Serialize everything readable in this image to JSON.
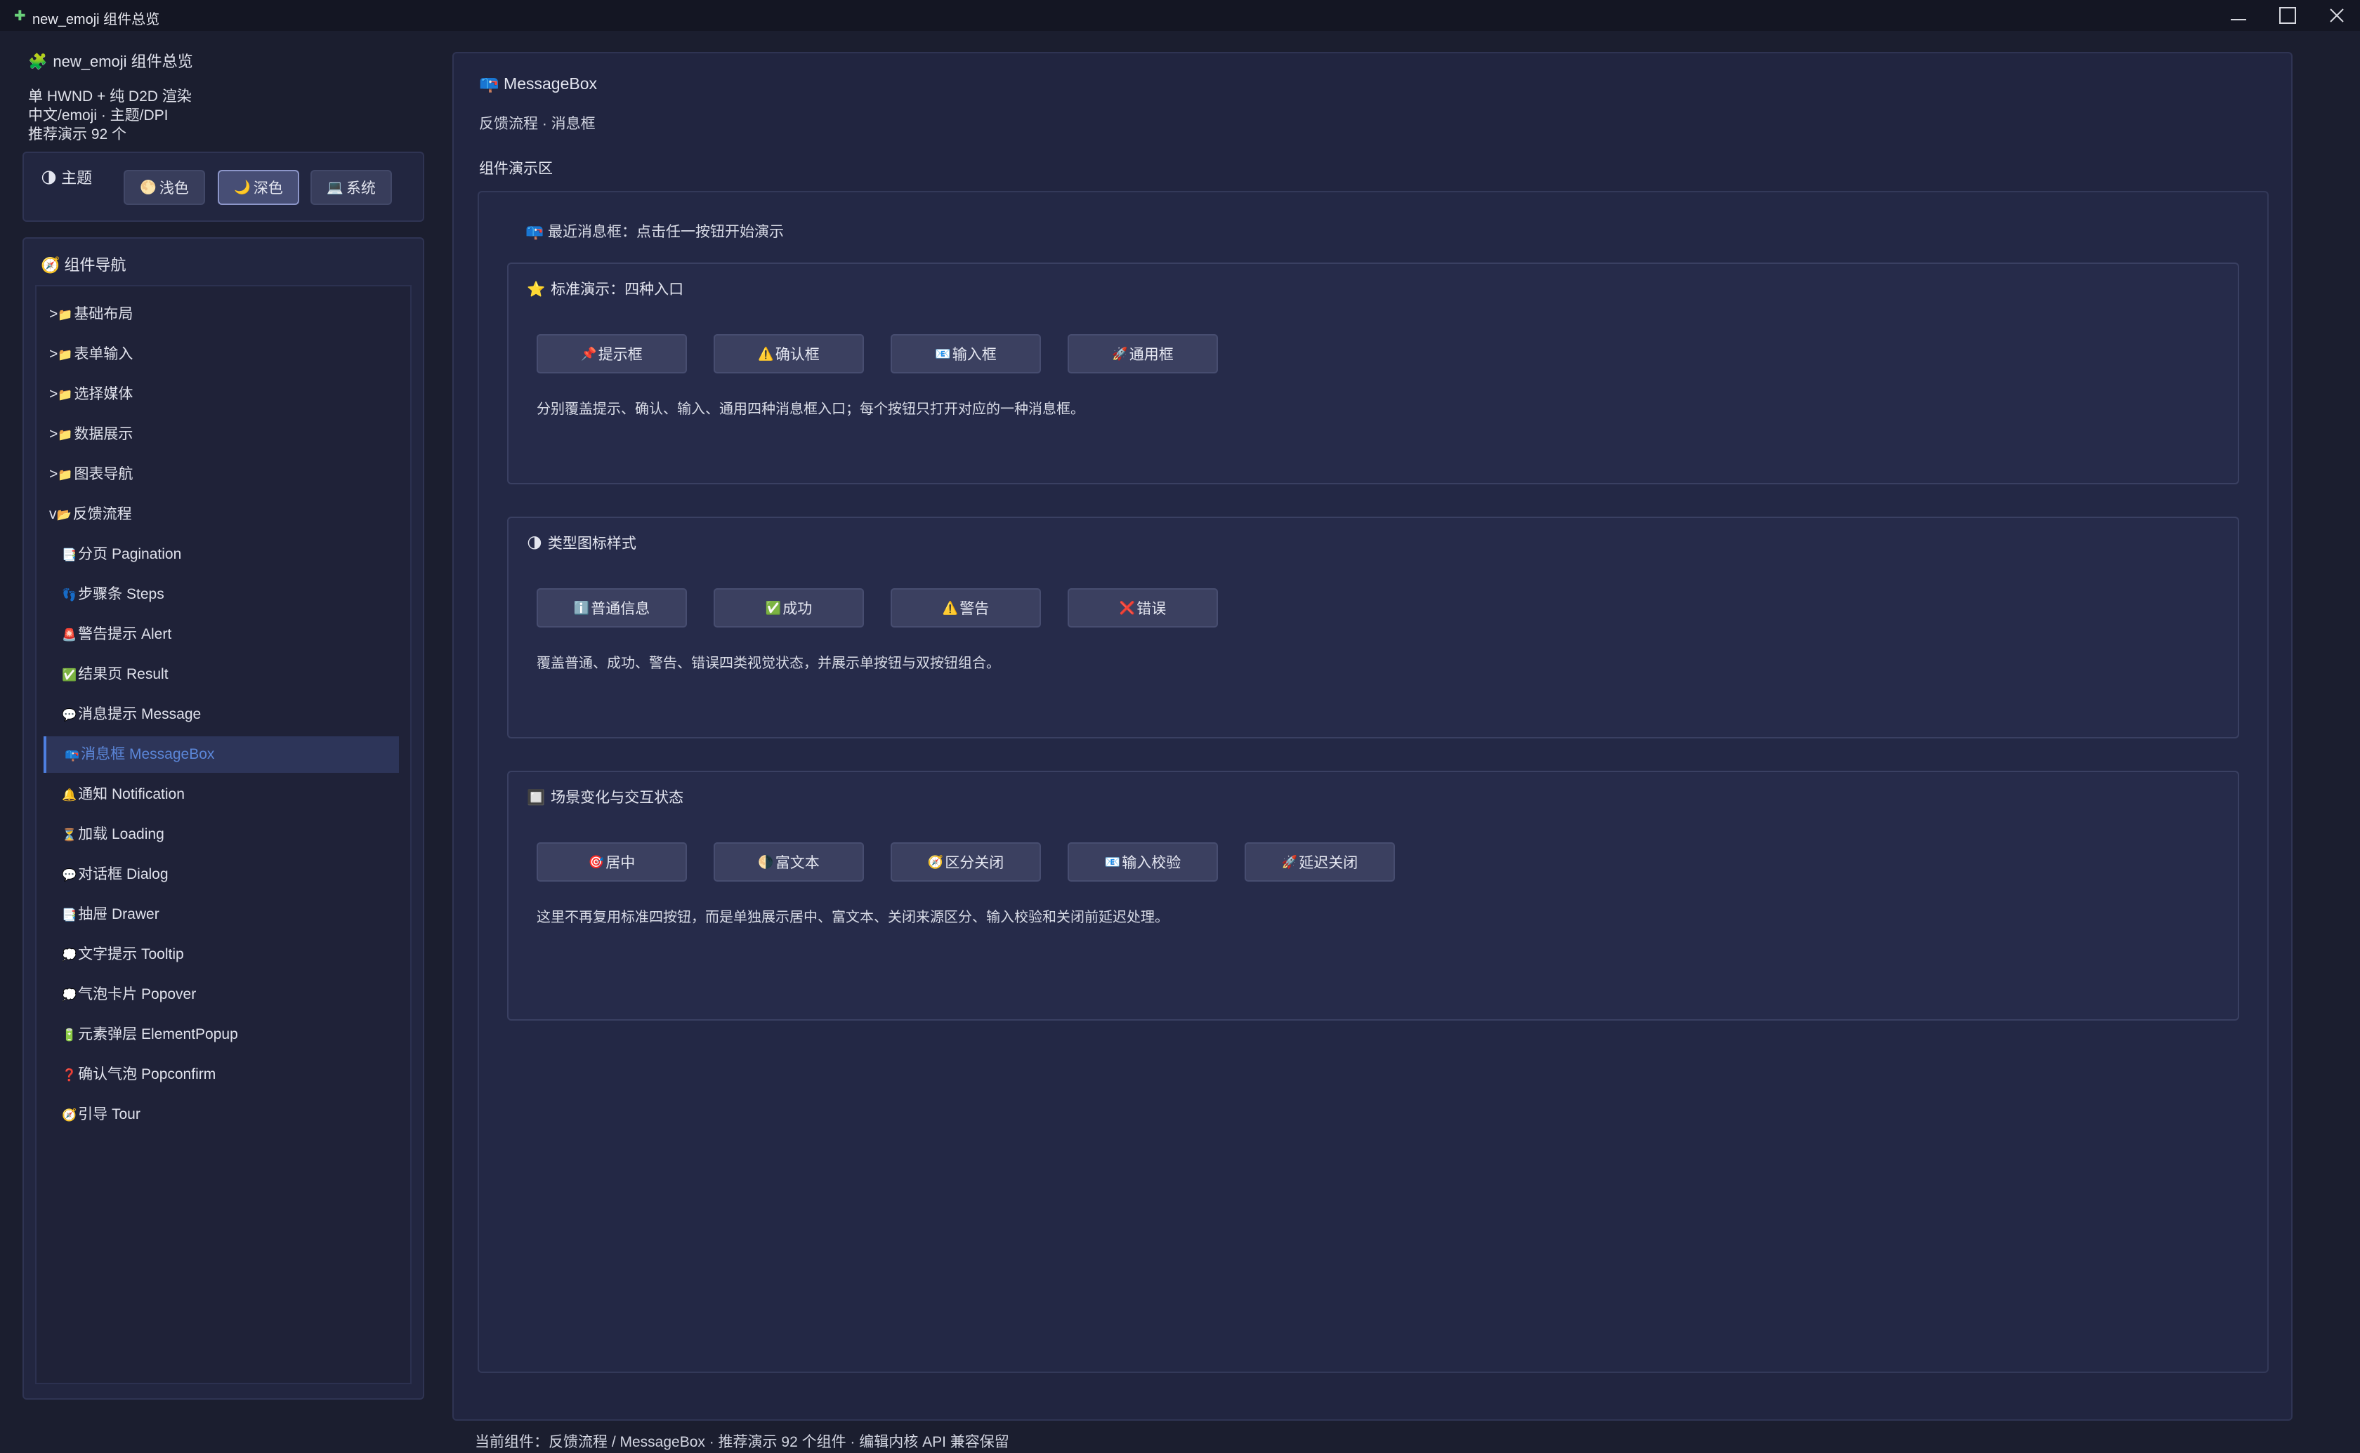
{
  "window": {
    "icon": "puzzle-icon",
    "title": "new_emoji 组件总览",
    "controls": {
      "minimize": "minimize-icon",
      "maximize": "maximize-icon",
      "close": "close-icon"
    }
  },
  "sidebar": {
    "header": {
      "icon": "puzzle-icon",
      "icon_glyph": "🧩",
      "title": "new_emoji 组件总览"
    },
    "meta": [
      "单 HWND + 纯 D2D 渲染",
      "中文/emoji · 主题/DPI",
      "推荐演示 92 个"
    ],
    "theme": {
      "icon_glyph": "🌗",
      "title": "主题",
      "options": [
        {
          "icon_glyph": "🌕",
          "label": "浅色",
          "active": false
        },
        {
          "icon_glyph": "🌙",
          "label": "深色",
          "active": true
        },
        {
          "icon_glyph": "💻",
          "label": "系统",
          "active": false
        }
      ]
    },
    "nav": {
      "icon_glyph": "🧭",
      "title": "组件导航",
      "groups": [
        {
          "prefix": ">",
          "icon_glyph": "📁",
          "label": "基础布局"
        },
        {
          "prefix": ">",
          "icon_glyph": "📁",
          "label": "表单输入"
        },
        {
          "prefix": ">",
          "icon_glyph": "📁",
          "label": "选择媒体"
        },
        {
          "prefix": ">",
          "icon_glyph": "📁",
          "label": "数据展示"
        },
        {
          "prefix": ">",
          "icon_glyph": "📁",
          "label": "图表导航"
        },
        {
          "prefix": "v",
          "icon_glyph": "📂",
          "label": "反馈流程"
        }
      ],
      "items": [
        {
          "icon_glyph": "📑",
          "label": "分页 Pagination"
        },
        {
          "icon_glyph": "👣",
          "label": "步骤条 Steps"
        },
        {
          "icon_glyph": "🚨",
          "label": "警告提示 Alert"
        },
        {
          "icon_glyph": "✅",
          "label": "结果页 Result"
        },
        {
          "icon_glyph": "💬",
          "label": "消息提示 Message"
        },
        {
          "icon_glyph": "📪",
          "label": "消息框 MessageBox",
          "active": true
        },
        {
          "icon_glyph": "🔔",
          "label": "通知 Notification"
        },
        {
          "icon_glyph": "⏳",
          "label": "加载 Loading"
        },
        {
          "icon_glyph": "💬",
          "label": "对话框 Dialog"
        },
        {
          "icon_glyph": "📑",
          "label": "抽屉 Drawer"
        },
        {
          "icon_glyph": "💭",
          "label": "文字提示 Tooltip"
        },
        {
          "icon_glyph": "💭",
          "label": "气泡卡片 Popover"
        },
        {
          "icon_glyph": "🔋",
          "label": "元素弹层 ElementPopup"
        },
        {
          "icon_glyph": "❓",
          "label": "确认气泡 Popconfirm"
        },
        {
          "icon_glyph": "🧭",
          "label": "引导 Tour"
        }
      ]
    }
  },
  "main": {
    "title_icon_glyph": "📪",
    "title": "MessageBox",
    "subtitle": "反馈流程 · 消息框",
    "area_label": "组件演示区",
    "recent": {
      "icon_glyph": "📪",
      "text": "最近消息框：点击任一按钮开始演示"
    },
    "cards": [
      {
        "icon_glyph": "⭐",
        "title": "标准演示：四种入口",
        "buttons": [
          {
            "icon_glyph": "📌",
            "label": "提示框"
          },
          {
            "icon_glyph": "⚠️",
            "label": "确认框"
          },
          {
            "icon_glyph": "📧",
            "label": "输入框"
          },
          {
            "icon_glyph": "🚀",
            "label": "通用框"
          }
        ],
        "description": "分别覆盖提示、确认、输入、通用四种消息框入口；每个按钮只打开对应的一种消息框。"
      },
      {
        "icon_glyph": "🌗",
        "title": "类型图标样式",
        "buttons": [
          {
            "icon_glyph": "ℹ️",
            "label": "普通信息"
          },
          {
            "icon_glyph": "✅",
            "label": "成功"
          },
          {
            "icon_glyph": "⚠️",
            "label": "警告"
          },
          {
            "icon_glyph": "❌",
            "label": "错误"
          }
        ],
        "description": "覆盖普通、成功、警告、错误四类视觉状态，并展示单按钮与双按钮组合。"
      },
      {
        "icon_glyph": "🔲",
        "title": "场景变化与交互状态",
        "buttons": [
          {
            "icon_glyph": "🎯",
            "label": "居中"
          },
          {
            "icon_glyph": "🌗",
            "label": "富文本"
          },
          {
            "icon_glyph": "🧭",
            "label": "区分关闭"
          },
          {
            "icon_glyph": "📧",
            "label": "输入校验"
          },
          {
            "icon_glyph": "🚀",
            "label": "延迟关闭"
          }
        ],
        "description": "这里不再复用标准四按钮，而是单独展示居中、富文本、关闭来源区分、输入校验和关闭前延迟处理。"
      }
    ]
  },
  "status": "当前组件：反馈流程 / MessageBox · 推荐演示 92 个组件 · 编辑内核 API 兼容保留",
  "colors": {
    "background": "#1b1e2f",
    "panel": "#222640",
    "accent": "#4e7fe0",
    "active_text": "#5b86d8"
  }
}
